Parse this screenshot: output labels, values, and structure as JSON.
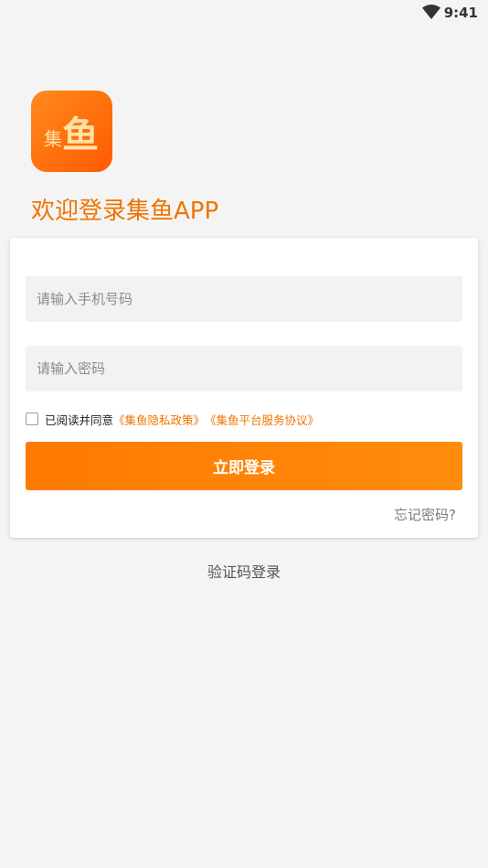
{
  "status_bar": {
    "time": "9:41",
    "icon": "wifi-icon"
  },
  "logo": {
    "text_small": "集",
    "text_large": "鱼",
    "colors": [
      "#ff8a1e",
      "#ff5a00"
    ]
  },
  "welcome": {
    "title": "欢迎登录集鱼APP"
  },
  "form": {
    "phone_placeholder": "请输入手机号码",
    "password_placeholder": "请输入密码",
    "agree_text": "已阅读并同意",
    "privacy_link": "《集鱼隐私政策》",
    "service_link": "《集鱼平台服务协议》",
    "login_button": "立即登录",
    "forgot_password": "忘记密码?"
  },
  "sms_login": "验证码登录",
  "colors": {
    "accent": "#f07400",
    "button": "#ff7a00",
    "background": "#f4f4f4"
  }
}
